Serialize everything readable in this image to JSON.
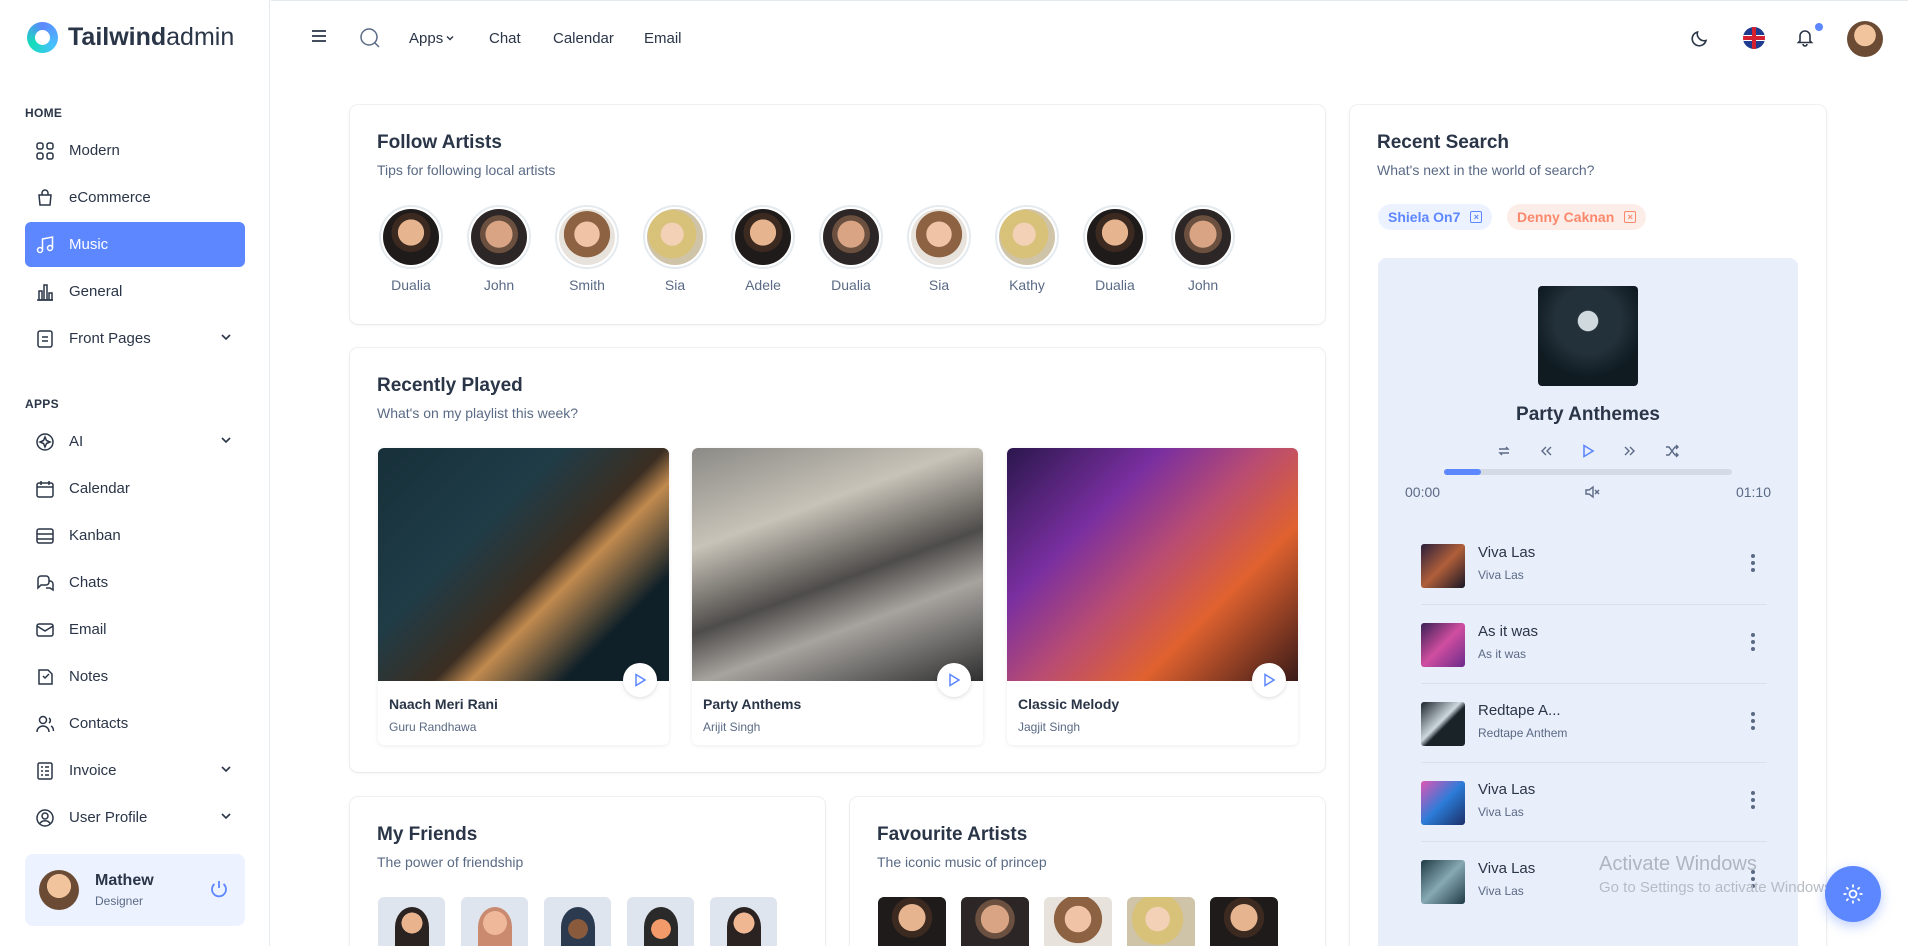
{
  "app": {
    "logo_bold": "Tailwind",
    "logo_light": "admin"
  },
  "sidebar": {
    "section_home": "HOME",
    "section_apps": "APPS",
    "home_items": [
      {
        "label": "Modern",
        "icon": "grid-icon"
      },
      {
        "label": "eCommerce",
        "icon": "basket-icon"
      },
      {
        "label": "Music",
        "icon": "music-note-icon",
        "active": true
      },
      {
        "label": "General",
        "icon": "chart-bars-icon"
      },
      {
        "label": "Front Pages",
        "icon": "page-icon",
        "has_submenu": true
      }
    ],
    "app_items": [
      {
        "label": "AI",
        "icon": "ai-badge-icon",
        "has_submenu": true
      },
      {
        "label": "Calendar",
        "icon": "calendar-icon"
      },
      {
        "label": "Kanban",
        "icon": "kanban-icon"
      },
      {
        "label": "Chats",
        "icon": "chat-bubbles-icon"
      },
      {
        "label": "Email",
        "icon": "mail-icon"
      },
      {
        "label": "Notes",
        "icon": "note-icon"
      },
      {
        "label": "Contacts",
        "icon": "contacts-icon"
      },
      {
        "label": "Invoice",
        "icon": "invoice-icon",
        "has_submenu": true
      },
      {
        "label": "User Profile",
        "icon": "user-circle-icon",
        "has_submenu": true
      }
    ],
    "user": {
      "name": "Mathew",
      "role": "Designer"
    }
  },
  "header": {
    "links": [
      "Apps",
      "Chat",
      "Calendar",
      "Email"
    ]
  },
  "follow_artists": {
    "title": "Follow Artists",
    "subtitle": "Tips for following local artists",
    "artists": [
      "Dualia",
      "John",
      "Smith",
      "Sia",
      "Adele",
      "Dualia",
      "Sia",
      "Kathy",
      "Dualia",
      "John"
    ]
  },
  "recently_played": {
    "title": "Recently Played",
    "subtitle": "What's on my playlist this week?",
    "songs": [
      {
        "title": "Naach Meri Rani",
        "artist": "Guru Randhawa"
      },
      {
        "title": "Party Anthems",
        "artist": "Arijit Singh"
      },
      {
        "title": "Classic Melody",
        "artist": "Jagjit Singh"
      }
    ]
  },
  "my_friends": {
    "title": "My Friends",
    "subtitle": "The power of friendship"
  },
  "favourite_artists": {
    "title": "Favourite Artists",
    "subtitle": "The iconic music of princep"
  },
  "recent_search": {
    "title": "Recent Search",
    "subtitle": "What's next in the world of search?",
    "chips": [
      {
        "label": "Shiela On7",
        "color": "#5d87ff",
        "bg": "#ecf2ff"
      },
      {
        "label": "Denny Caknan",
        "color": "#fa896b",
        "bg": "#fdede8"
      }
    ]
  },
  "player": {
    "now_playing": "Party Anthemes",
    "time_elapsed": "00:00",
    "time_total": "01:10",
    "progress": 0.13,
    "tracks": [
      {
        "title": "Viva Las",
        "artist": "Viva Las"
      },
      {
        "title": "As it was",
        "artist": "As it was"
      },
      {
        "title": "Redtape A...",
        "artist": "Redtape Anthem"
      },
      {
        "title": "Viva Las",
        "artist": "Viva Las"
      },
      {
        "title": "Viva Las",
        "artist": "Viva Las"
      }
    ]
  },
  "watermark": {
    "line1": "Activate Windows",
    "line2": "Go to Settings to activate Windows."
  },
  "colors": {
    "primary": "#5d87ff",
    "text": "#2a3547",
    "muted": "#5a6a85"
  }
}
